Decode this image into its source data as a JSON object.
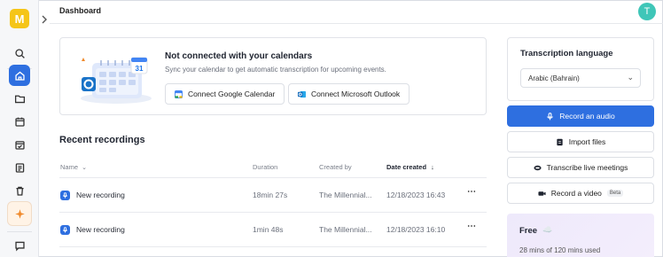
{
  "app": {
    "logo_letter": "M",
    "page_title": "Dashboard",
    "avatar_letter": "T"
  },
  "calendar_card": {
    "title": "Not connected with your calendars",
    "subtitle": "Sync your calendar to get automatic transcription for upcoming events.",
    "google_label": "Connect Google Calendar",
    "outlook_label": "Connect Microsoft Outlook",
    "calendar_day": "31"
  },
  "recent": {
    "title": "Recent recordings",
    "columns": {
      "name": "Name",
      "duration": "Duration",
      "created_by": "Created by",
      "date_created": "Date created"
    },
    "rows": [
      {
        "name": "New recording",
        "duration": "18min 27s",
        "created_by": "The Millennial...",
        "date": "12/18/2023 16:43"
      },
      {
        "name": "New recording",
        "duration": "1min 48s",
        "created_by": "The Millennial...",
        "date": "12/18/2023 16:10"
      }
    ]
  },
  "transcription": {
    "label": "Transcription language",
    "selected": "Arabic (Bahrain)"
  },
  "actions": {
    "record_audio": "Record an audio",
    "import_files": "Import files",
    "transcribe_live": "Transcribe live meetings",
    "record_video": "Record a video",
    "beta": "Beta"
  },
  "plan": {
    "name": "Free",
    "emoji": "☁️",
    "usage": "28 mins of 120 mins used"
  },
  "colors": {
    "accent": "#2e6fe0",
    "logo": "#f5c518",
    "avatar": "#3fc6b8"
  },
  "icons": [
    "chevron-right-icon",
    "search-icon",
    "home-icon",
    "folder-icon",
    "calendar-icon",
    "calendar-check-icon",
    "tasks-icon",
    "trash-icon",
    "sparkle-icon",
    "chat-icon",
    "microphone-icon",
    "file-icon",
    "headset-icon",
    "video-icon",
    "more-icon"
  ]
}
